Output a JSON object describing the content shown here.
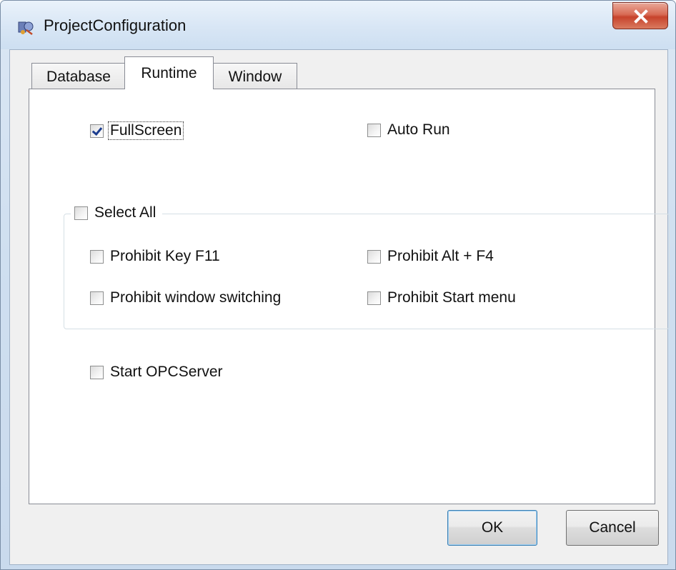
{
  "window": {
    "title": "ProjectConfiguration"
  },
  "title_bar": {
    "icon": "app-icon",
    "close_icon": "close-icon"
  },
  "tabs": [
    {
      "label": "Database",
      "active": false
    },
    {
      "label": "Runtime",
      "active": true
    },
    {
      "label": "Window",
      "active": false
    }
  ],
  "runtime": {
    "fullscreen": {
      "label": "FullScreen",
      "checked": true
    },
    "auto_run": {
      "label": "Auto Run",
      "checked": false
    },
    "select_all": {
      "label": "Select All",
      "checked": false
    },
    "prohibit_key_f11": {
      "label": "Prohibit Key F11",
      "checked": false
    },
    "prohibit_alt_f4": {
      "label": "Prohibit Alt + F4",
      "checked": false
    },
    "prohibit_window_switching": {
      "label": "Prohibit window switching",
      "checked": false
    },
    "prohibit_start_menu": {
      "label": "Prohibit Start menu",
      "checked": false
    },
    "start_opcserver": {
      "label": "Start OPCServer",
      "checked": false
    }
  },
  "buttons": {
    "ok": "OK",
    "cancel": "Cancel"
  },
  "colors": {
    "title_bar": "#d8e6f5",
    "close_button": "#c7432c",
    "dialog_bg": "#f0f0f0",
    "ok_border": "#3c7fb1"
  }
}
